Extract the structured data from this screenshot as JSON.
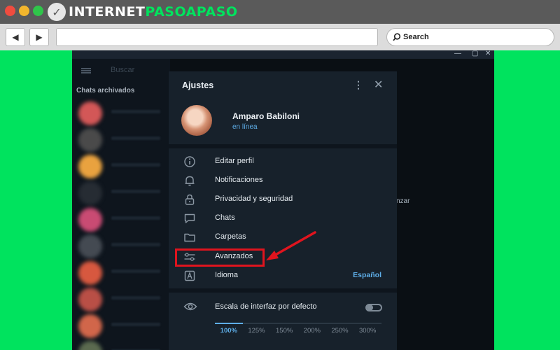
{
  "site": {
    "brand_first": "INTERNET",
    "brand_second": "PASOAPASO",
    "search_label": "Search"
  },
  "telegram": {
    "left_panel": {
      "search_placeholder": "Buscar",
      "archived_label": "Chats archivados",
      "chat_avatar_colors": [
        "#d35757",
        "#4a4a4a",
        "#e9a23f",
        "#262c33",
        "#c94b73",
        "#444a52",
        "#d7583f",
        "#b94f46",
        "#d1664a",
        "#5b6a4f"
      ]
    },
    "background_text": "nzar",
    "settings": {
      "title": "Ajustes",
      "more_icon": "more-vertical-icon",
      "close_icon": "close-icon",
      "user": {
        "name": "Amparo Babiloni",
        "status": "en línea"
      },
      "menu": [
        {
          "icon": "info-icon",
          "label": "Editar perfil"
        },
        {
          "icon": "bell-icon",
          "label": "Notificaciones"
        },
        {
          "icon": "lock-icon",
          "label": "Privacidad y seguridad"
        },
        {
          "icon": "chat-bubble-icon",
          "label": "Chats"
        },
        {
          "icon": "folder-icon",
          "label": "Carpetas"
        },
        {
          "icon": "sliders-icon",
          "label": "Avanzados"
        },
        {
          "icon": "language-icon",
          "label": "Idioma",
          "value": "Español"
        }
      ],
      "interface_scale": {
        "label": "Escala de interfaz por defecto",
        "default_enabled": false,
        "options": [
          "100%",
          "125%",
          "150%",
          "200%",
          "250%",
          "300%"
        ],
        "selected": "100%"
      }
    }
  },
  "colors": {
    "accent": "#5eaee8",
    "highlight": "#e0141e",
    "page_background": "#00e35e"
  }
}
